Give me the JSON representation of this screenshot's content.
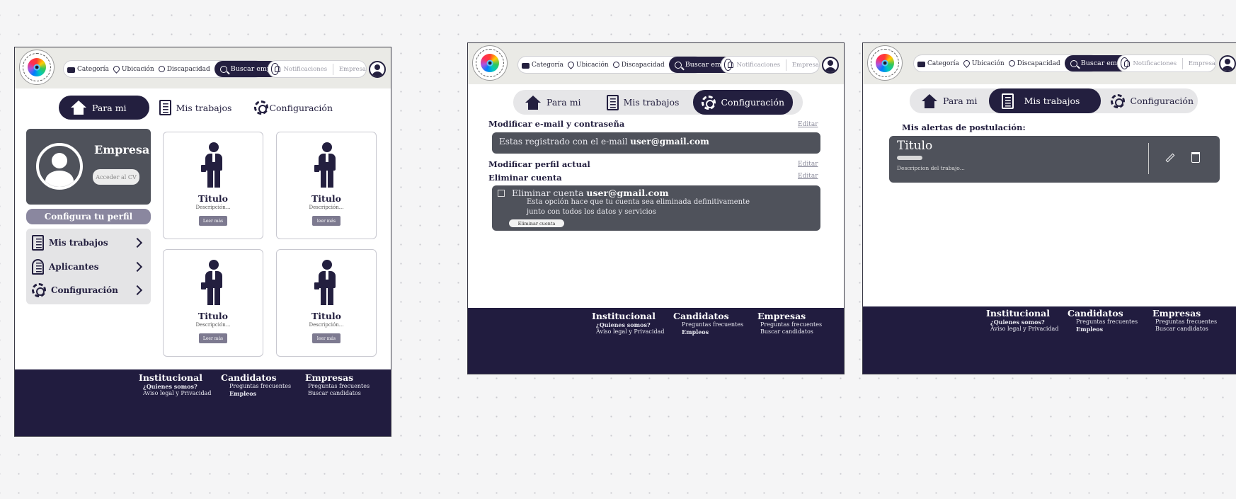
{
  "header": {
    "logo": {
      "top_text": "N E W",
      "bottom_text": "V I S I O N"
    },
    "search": {
      "category": "Categoría",
      "location": "Ubicación",
      "disability": "Discapacidad",
      "button": "Buscar empleo"
    },
    "notifications": "Notificaciones",
    "company": "Empresa"
  },
  "tabs": {
    "para_mi": "Para mi",
    "mis_trabajos": "Mis trabajos",
    "configuracion": "Configuración"
  },
  "footer": {
    "institucional": {
      "title": "Institucional",
      "links": [
        "¿Quienes somos?",
        "Aviso legal y Privacidad"
      ]
    },
    "candidatos": {
      "title": "Candidatos",
      "links": [
        "Preguntas frecuentes",
        "Empleos"
      ]
    },
    "empresas": {
      "title": "Empresas",
      "links": [
        "Preguntas frecuentes",
        "Buscar candidatos"
      ]
    }
  },
  "screen1": {
    "profile": {
      "name": "Empresa",
      "button": "Acceder al CV"
    },
    "config_button": "Configura tu perfil",
    "menu": [
      "Mis trabajos",
      "Aplicantes",
      "Configuración"
    ],
    "jobs": [
      {
        "title": "Titulo",
        "desc": "Descripción...",
        "button": "Leer más"
      },
      {
        "title": "Titulo",
        "desc": "Descripción...",
        "button": "leer más"
      },
      {
        "title": "Titulo",
        "desc": "Descripción...",
        "button": "Leer más"
      },
      {
        "title": "Titulo",
        "desc": "Descripción...",
        "button": "leer más"
      }
    ]
  },
  "screen2": {
    "section1": {
      "title": "Modificar e-mail y contraseña",
      "edit": "Editar",
      "text": "Estas registrado con el e-mail",
      "email": "user@gmail.com"
    },
    "section2": {
      "title": "Modificar perfil actual",
      "edit": "Editar"
    },
    "section3": {
      "title": "Eliminar cuenta",
      "edit": "Editar",
      "label": "Eliminar cuenta",
      "email": "user@gmail.com",
      "line1": "Esta opción hace que tu cuenta sea eliminada definitivamente",
      "line2": "junto con todos los datos y servicios",
      "button": "Eliminar cuenta"
    }
  },
  "screen3": {
    "heading": "Mis alertas de postulación:",
    "alert": {
      "title": "Titulo",
      "desc": "Descripcion del trabajo..."
    }
  }
}
